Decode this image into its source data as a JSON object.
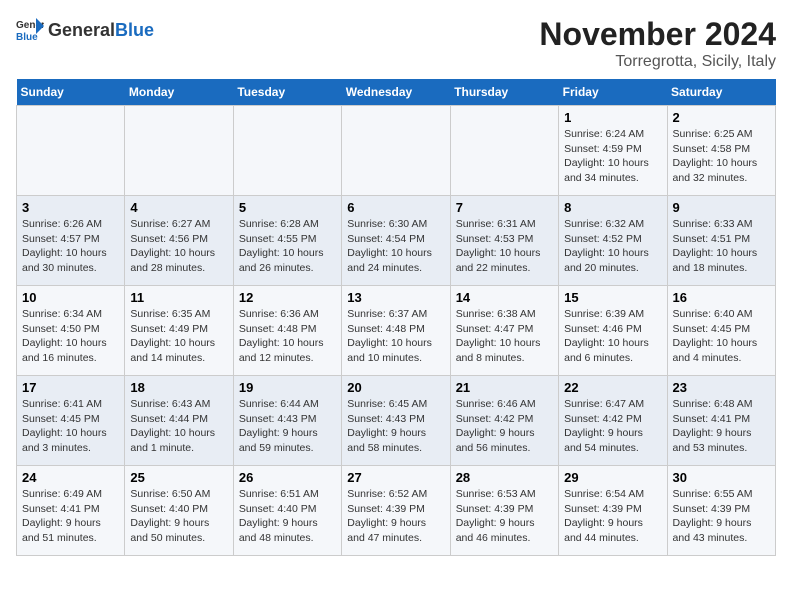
{
  "logo": {
    "general": "General",
    "blue": "Blue"
  },
  "title": "November 2024",
  "subtitle": "Torregrotta, Sicily, Italy",
  "days_of_week": [
    "Sunday",
    "Monday",
    "Tuesday",
    "Wednesday",
    "Thursday",
    "Friday",
    "Saturday"
  ],
  "weeks": [
    [
      {
        "day": "",
        "detail": ""
      },
      {
        "day": "",
        "detail": ""
      },
      {
        "day": "",
        "detail": ""
      },
      {
        "day": "",
        "detail": ""
      },
      {
        "day": "",
        "detail": ""
      },
      {
        "day": "1",
        "detail": "Sunrise: 6:24 AM\nSunset: 4:59 PM\nDaylight: 10 hours and 34 minutes."
      },
      {
        "day": "2",
        "detail": "Sunrise: 6:25 AM\nSunset: 4:58 PM\nDaylight: 10 hours and 32 minutes."
      }
    ],
    [
      {
        "day": "3",
        "detail": "Sunrise: 6:26 AM\nSunset: 4:57 PM\nDaylight: 10 hours and 30 minutes."
      },
      {
        "day": "4",
        "detail": "Sunrise: 6:27 AM\nSunset: 4:56 PM\nDaylight: 10 hours and 28 minutes."
      },
      {
        "day": "5",
        "detail": "Sunrise: 6:28 AM\nSunset: 4:55 PM\nDaylight: 10 hours and 26 minutes."
      },
      {
        "day": "6",
        "detail": "Sunrise: 6:30 AM\nSunset: 4:54 PM\nDaylight: 10 hours and 24 minutes."
      },
      {
        "day": "7",
        "detail": "Sunrise: 6:31 AM\nSunset: 4:53 PM\nDaylight: 10 hours and 22 minutes."
      },
      {
        "day": "8",
        "detail": "Sunrise: 6:32 AM\nSunset: 4:52 PM\nDaylight: 10 hours and 20 minutes."
      },
      {
        "day": "9",
        "detail": "Sunrise: 6:33 AM\nSunset: 4:51 PM\nDaylight: 10 hours and 18 minutes."
      }
    ],
    [
      {
        "day": "10",
        "detail": "Sunrise: 6:34 AM\nSunset: 4:50 PM\nDaylight: 10 hours and 16 minutes."
      },
      {
        "day": "11",
        "detail": "Sunrise: 6:35 AM\nSunset: 4:49 PM\nDaylight: 10 hours and 14 minutes."
      },
      {
        "day": "12",
        "detail": "Sunrise: 6:36 AM\nSunset: 4:48 PM\nDaylight: 10 hours and 12 minutes."
      },
      {
        "day": "13",
        "detail": "Sunrise: 6:37 AM\nSunset: 4:48 PM\nDaylight: 10 hours and 10 minutes."
      },
      {
        "day": "14",
        "detail": "Sunrise: 6:38 AM\nSunset: 4:47 PM\nDaylight: 10 hours and 8 minutes."
      },
      {
        "day": "15",
        "detail": "Sunrise: 6:39 AM\nSunset: 4:46 PM\nDaylight: 10 hours and 6 minutes."
      },
      {
        "day": "16",
        "detail": "Sunrise: 6:40 AM\nSunset: 4:45 PM\nDaylight: 10 hours and 4 minutes."
      }
    ],
    [
      {
        "day": "17",
        "detail": "Sunrise: 6:41 AM\nSunset: 4:45 PM\nDaylight: 10 hours and 3 minutes."
      },
      {
        "day": "18",
        "detail": "Sunrise: 6:43 AM\nSunset: 4:44 PM\nDaylight: 10 hours and 1 minute."
      },
      {
        "day": "19",
        "detail": "Sunrise: 6:44 AM\nSunset: 4:43 PM\nDaylight: 9 hours and 59 minutes."
      },
      {
        "day": "20",
        "detail": "Sunrise: 6:45 AM\nSunset: 4:43 PM\nDaylight: 9 hours and 58 minutes."
      },
      {
        "day": "21",
        "detail": "Sunrise: 6:46 AM\nSunset: 4:42 PM\nDaylight: 9 hours and 56 minutes."
      },
      {
        "day": "22",
        "detail": "Sunrise: 6:47 AM\nSunset: 4:42 PM\nDaylight: 9 hours and 54 minutes."
      },
      {
        "day": "23",
        "detail": "Sunrise: 6:48 AM\nSunset: 4:41 PM\nDaylight: 9 hours and 53 minutes."
      }
    ],
    [
      {
        "day": "24",
        "detail": "Sunrise: 6:49 AM\nSunset: 4:41 PM\nDaylight: 9 hours and 51 minutes."
      },
      {
        "day": "25",
        "detail": "Sunrise: 6:50 AM\nSunset: 4:40 PM\nDaylight: 9 hours and 50 minutes."
      },
      {
        "day": "26",
        "detail": "Sunrise: 6:51 AM\nSunset: 4:40 PM\nDaylight: 9 hours and 48 minutes."
      },
      {
        "day": "27",
        "detail": "Sunrise: 6:52 AM\nSunset: 4:39 PM\nDaylight: 9 hours and 47 minutes."
      },
      {
        "day": "28",
        "detail": "Sunrise: 6:53 AM\nSunset: 4:39 PM\nDaylight: 9 hours and 46 minutes."
      },
      {
        "day": "29",
        "detail": "Sunrise: 6:54 AM\nSunset: 4:39 PM\nDaylight: 9 hours and 44 minutes."
      },
      {
        "day": "30",
        "detail": "Sunrise: 6:55 AM\nSunset: 4:39 PM\nDaylight: 9 hours and 43 minutes."
      }
    ]
  ]
}
